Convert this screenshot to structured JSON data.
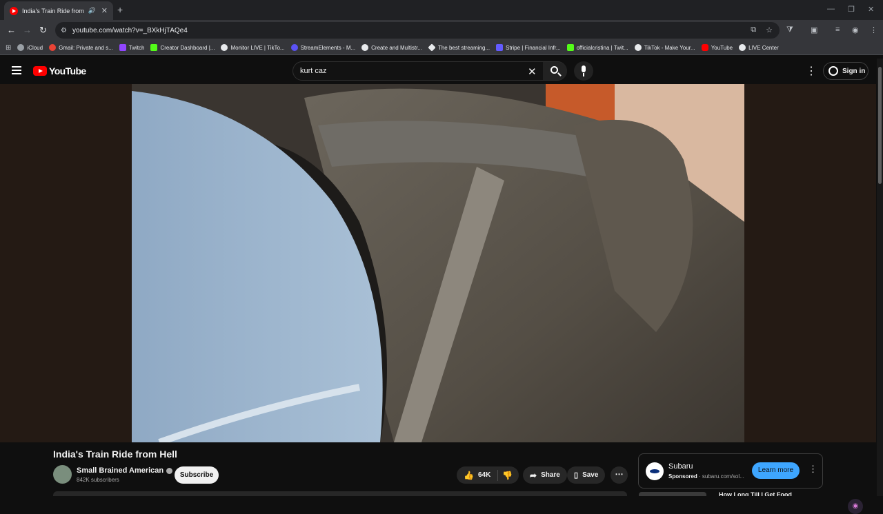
{
  "browser": {
    "tab_title": "India's Train Ride from Hell",
    "url": "youtube.com/watch?v=_BXkHjTAQe4",
    "bookmarks": [
      {
        "label": "iCloud",
        "color": "#9aa0a6"
      },
      {
        "label": "Gmail: Private and s...",
        "color": "#ea4335"
      },
      {
        "label": "Twitch",
        "color": "#9146ff"
      },
      {
        "label": "Creator Dashboard |...",
        "color": "#53fc18"
      },
      {
        "label": "Monitor LIVE | TikTo...",
        "color": "#e8eaed"
      },
      {
        "label": "StreamElements - M...",
        "color": "#5b52f5"
      },
      {
        "label": "Create and Multistr...",
        "color": "#e8eaed"
      },
      {
        "label": "The best streaming...",
        "color": "#e8eaed"
      },
      {
        "label": "Stripe | Financial Infr...",
        "color": "#635bff"
      },
      {
        "label": "officialcristina | Twit...",
        "color": "#53fc18"
      },
      {
        "label": "TikTok - Make Your...",
        "color": "#e8eaed"
      },
      {
        "label": "YouTube",
        "color": "#ff0000"
      },
      {
        "label": "LIVE Center",
        "color": "#e8eaed"
      }
    ]
  },
  "youtube": {
    "logo_text": "YouTube",
    "search_query": "kurt caz",
    "sign_in_label": "Sign in"
  },
  "video": {
    "title": "India's Train Ride from Hell",
    "channel": "Small Brained American",
    "subscribers": "842K subscribers",
    "subscribe_label": "Subscribe",
    "likes": "64K",
    "share_label": "Share",
    "save_label": "Save"
  },
  "ad": {
    "name": "Subaru",
    "sponsored": "Sponsored",
    "domain": "subaru.com/sol...",
    "cta": "Learn more"
  },
  "next_video": {
    "title": "How Long Till I Get Food"
  }
}
